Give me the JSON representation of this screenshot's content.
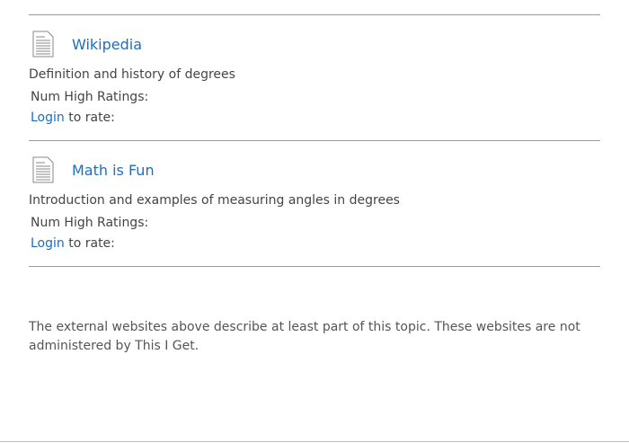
{
  "resources": [
    {
      "title": "Wikipedia",
      "description": "Definition and history of degrees",
      "ratings_label": "Num High Ratings:",
      "login_label": "Login",
      "rate_suffix": " to rate:"
    },
    {
      "title": "Math is Fun",
      "description": "Introduction and examples of measuring angles in degrees",
      "ratings_label": "Num High Ratings:",
      "login_label": "Login",
      "rate_suffix": " to rate:"
    }
  ],
  "disclaimer": "The external websites above describe at least part of this topic. These websites are not administered by This I Get.",
  "icons": {
    "resource": "document-icon"
  },
  "colors": {
    "link": "#1a6ec4",
    "text": "#444444",
    "divider": "#9a9a9a"
  }
}
